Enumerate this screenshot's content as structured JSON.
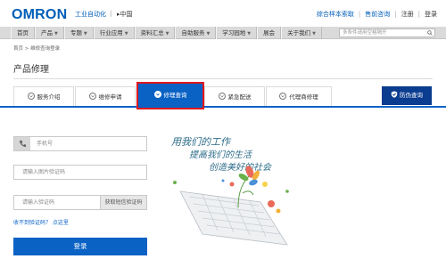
{
  "header": {
    "logo": "OMRON",
    "brand_sub": "工业自动化",
    "brand_sep": "|",
    "region": "▸中国",
    "links": [
      "综合样本索取",
      "售前咨询",
      "注册",
      "登录"
    ],
    "link_sep": "|"
  },
  "nav": {
    "items": [
      {
        "label": "首页",
        "has_arrow": false
      },
      {
        "label": "产品",
        "has_arrow": true
      },
      {
        "label": "专题",
        "has_arrow": true
      },
      {
        "label": "行业应用",
        "has_arrow": true
      },
      {
        "label": "资料汇总",
        "has_arrow": true
      },
      {
        "label": "自助服务",
        "has_arrow": true
      },
      {
        "label": "学习园地",
        "has_arrow": true
      },
      {
        "label": "展会",
        "has_arrow": false
      },
      {
        "label": "关于我们",
        "has_arrow": true
      }
    ],
    "arrow_glyph": "▼",
    "search_placeholder": "多条件请用空格隔开"
  },
  "breadcrumb": "首页 > 维修查询登录",
  "page_title": "产品修理",
  "tabs": [
    {
      "label": "服务介绍",
      "active": false
    },
    {
      "label": "维修申请",
      "active": false
    },
    {
      "label": "修理查询",
      "active": true
    },
    {
      "label": "紧急配送",
      "active": false
    },
    {
      "label": "代理商修理",
      "active": false
    }
  ],
  "special_tab": {
    "label": "防伪查询"
  },
  "form": {
    "phone_placeholder": "手机号",
    "captcha_placeholder": "请输入图片验证码",
    "sms_placeholder": "请输入验证码",
    "sms_button": "获取短信验证码",
    "no_code_link": "收不到验证码？ 点这里",
    "login_button": "登录"
  },
  "illustration": {
    "lines": [
      "用我们的工作",
      "提高我们的生活",
      "创造美好的社会"
    ]
  },
  "colors": {
    "brand_blue": "#005eb8",
    "active_tab": "#0a62c5",
    "highlight_border": "#e0191e",
    "special_tab": "#0a3c8f"
  }
}
